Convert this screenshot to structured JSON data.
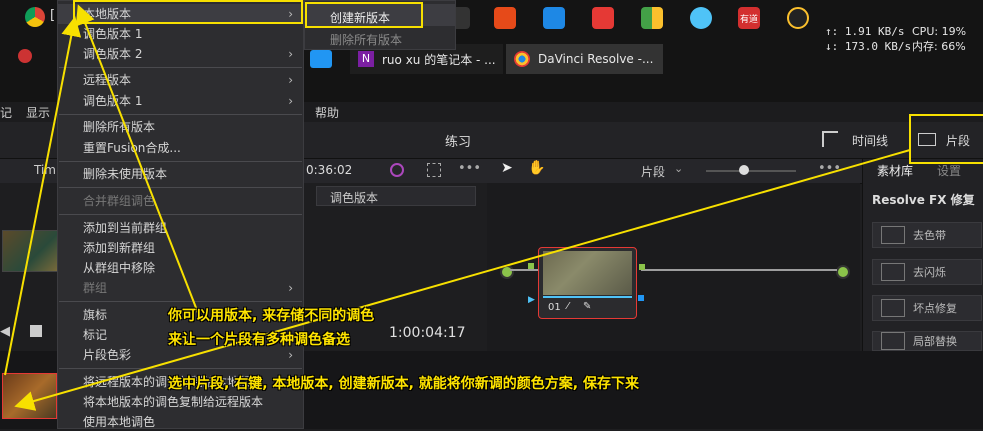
{
  "taskbar": {
    "netstats": {
      "up": "↑: 1.91 KB/s",
      "down": "↓: 173.0 KB/s"
    },
    "cpustats": {
      "cpu": "CPU: 19%",
      "mem": "内存: 66%"
    },
    "tabs": [
      {
        "label": "ruo xu 的笔记本 - ...",
        "icon": "onenote-icon"
      },
      {
        "label": "DaVinci Resolve -...",
        "icon": "davinci-icon"
      }
    ],
    "browser_tab_label": "[",
    "tray_badge": "有道"
  },
  "app": {
    "menubar": [
      "记",
      "显示",
      "帮助"
    ],
    "header": {
      "project_title": "练习",
      "timeline_btn": "时间线",
      "clips_btn": "片段"
    },
    "toolbar": {
      "timecode": "0:36:02",
      "clips_dropdown": "片段",
      "left_label": "Tim"
    },
    "version_dropdown": "调色版本",
    "right_panel": {
      "tabs": [
        "素材库",
        "设置"
      ],
      "section_title": "Resolve FX 修复",
      "buttons": [
        "去色带",
        "去闪烁",
        "坏点修复",
        "局部替换"
      ]
    },
    "node": {
      "label": "01"
    },
    "viewer_timecode": "1:00:04:17"
  },
  "context_menu": {
    "items": [
      {
        "label": "本地版本",
        "submenu": true,
        "disabled": false
      },
      {
        "label": "调色版本 1",
        "submenu": false,
        "disabled": false
      },
      {
        "label": "调色版本 2",
        "submenu": true,
        "disabled": false
      },
      {
        "label": "远程版本",
        "submenu": true,
        "disabled": false
      },
      {
        "label": "调色版本 1",
        "submenu": true,
        "disabled": false
      },
      {
        "label": "删除所有版本",
        "submenu": false,
        "disabled": false
      },
      {
        "label": "重置Fusion合成...",
        "submenu": false,
        "disabled": false
      },
      {
        "label": "删除未使用版本",
        "submenu": false,
        "disabled": false
      },
      {
        "label": "合并群组调色",
        "submenu": false,
        "disabled": true
      },
      {
        "label": "添加到当前群组",
        "submenu": false,
        "disabled": false
      },
      {
        "label": "添加到新群组",
        "submenu": false,
        "disabled": false
      },
      {
        "label": "从群组中移除",
        "submenu": false,
        "disabled": false
      },
      {
        "label": "群组",
        "submenu": true,
        "disabled": true
      },
      {
        "label": "旗标",
        "submenu": true,
        "disabled": false
      },
      {
        "label": "标记",
        "submenu": true,
        "disabled": false
      },
      {
        "label": "片段色彩",
        "submenu": true,
        "disabled": false
      },
      {
        "label": "将远程版本的调色复制给本地版本",
        "submenu": false,
        "disabled": false
      },
      {
        "label": "将本地版本的调色复制给远程版本",
        "submenu": false,
        "disabled": false
      },
      {
        "label": "使用本地调色",
        "submenu": false,
        "disabled": false
      }
    ]
  },
  "submenu": {
    "items": [
      {
        "label": "创建新版本",
        "disabled": false
      },
      {
        "label": "删除所有版本",
        "disabled": true
      }
    ]
  },
  "annotations": {
    "note1_line1": "你可以用版本, 来存储不同的调色",
    "note1_line2": "来让一个片段有多种调色备选",
    "note2": "选中片段, 右键, 本地版本, 创建新版本, 就能将你新调的颜色方案, 保存下来",
    "color": "#ffe400"
  }
}
